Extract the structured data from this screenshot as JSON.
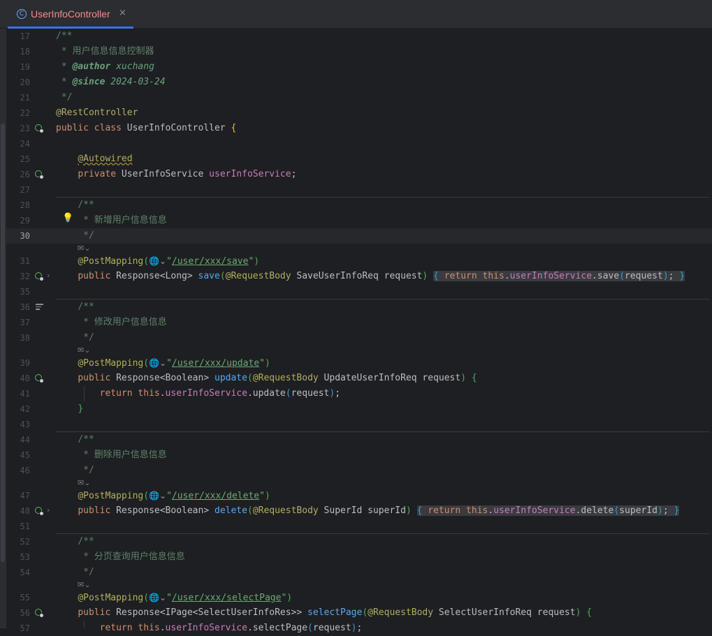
{
  "tab": {
    "title": "UserInfoController",
    "icon": "class-icon",
    "close": "×"
  },
  "lines": [
    {
      "n": "17",
      "t": "/**"
    },
    {
      "n": "18",
      "t": " * 用户信息信息控制器"
    },
    {
      "n": "19",
      "t": " * @author xuchang"
    },
    {
      "n": "20",
      "t": " * @since 2024-03-24"
    },
    {
      "n": "21",
      "t": " */"
    },
    {
      "n": "22",
      "t": "@RestController"
    },
    {
      "n": "23",
      "t": "public class UserInfoController {"
    },
    {
      "n": "24",
      "t": ""
    },
    {
      "n": "25",
      "t": "    @Autowired"
    },
    {
      "n": "26",
      "t": "    private UserInfoService userInfoService;"
    },
    {
      "n": "27",
      "t": ""
    },
    {
      "n": "28",
      "t": "    /**"
    },
    {
      "n": "29",
      "t": "     * 新增用户信息信息"
    },
    {
      "n": "30",
      "t": "     */"
    },
    {
      "n": "31",
      "t": "    @PostMapping(\"/user/xxx/save\")"
    },
    {
      "n": "32",
      "t": "    public Response<Long> save(@RequestBody SaveUserInfoReq request) { return this.userInfoService.save(request); }"
    },
    {
      "n": "35",
      "t": ""
    },
    {
      "n": "36",
      "t": "    /**"
    },
    {
      "n": "37",
      "t": "     * 修改用户信息信息"
    },
    {
      "n": "38",
      "t": "     */"
    },
    {
      "n": "39",
      "t": "    @PostMapping(\"/user/xxx/update\")"
    },
    {
      "n": "40",
      "t": "    public Response<Boolean> update(@RequestBody UpdateUserInfoReq request) {"
    },
    {
      "n": "41",
      "t": "        return this.userInfoService.update(request);"
    },
    {
      "n": "42",
      "t": "    }"
    },
    {
      "n": "43",
      "t": ""
    },
    {
      "n": "44",
      "t": "    /**"
    },
    {
      "n": "45",
      "t": "     * 删除用户信息信息"
    },
    {
      "n": "46",
      "t": "     */"
    },
    {
      "n": "47",
      "t": "    @PostMapping(\"/user/xxx/delete\")"
    },
    {
      "n": "48",
      "t": "    public Response<Boolean> delete(@RequestBody SuperId superId) { return this.userInfoService.delete(superId); }"
    },
    {
      "n": "51",
      "t": ""
    },
    {
      "n": "52",
      "t": "    /**"
    },
    {
      "n": "53",
      "t": "     * 分页查询用户信息信息"
    },
    {
      "n": "54",
      "t": "     */"
    },
    {
      "n": "55",
      "t": "    @PostMapping(\"/user/xxx/selectPage\")"
    },
    {
      "n": "56",
      "t": "    public Response<IPage<SelectUserInfoRes>> selectPage(@RequestBody SelectUserInfoReq request) {"
    },
    {
      "n": "57",
      "t": "        return this.userInfoService.selectPage(request);"
    }
  ],
  "current_line": "30",
  "inlay_hint": "✉⌄",
  "globe_hint": "🌐⌄",
  "colors": {
    "background": "#1e1f22",
    "keyword": "#cf8e6d",
    "function": "#56a8f5",
    "field": "#c77dbb",
    "string": "#6aab73",
    "annotation": "#b3ae60",
    "doc_comment": "#5f826b",
    "tab_title": "#f88a8a",
    "tab_underline": "#3574f0"
  },
  "icons": {
    "gutter_bean": "spring-bean-icon",
    "gutter_injection": "injection-icon",
    "gutter_endpoint": "web-endpoint-icon",
    "gutter_doc": "rendered-doc-icon",
    "bulb": "bulb-icon",
    "fold": "chevron-right-icon"
  }
}
